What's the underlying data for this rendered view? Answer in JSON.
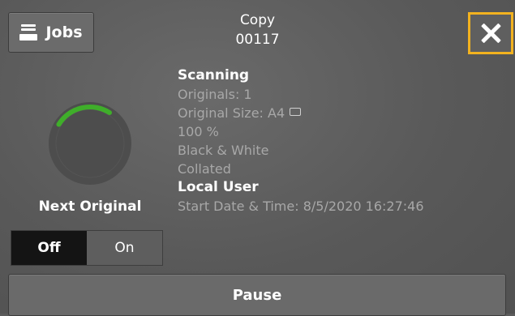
{
  "header": {
    "jobs_label": "Jobs",
    "title": "Copy",
    "job_number": "00117"
  },
  "status": {
    "heading": "Scanning",
    "originals": "Originals: 1",
    "original_size": "Original Size: A4",
    "scale": "100 %",
    "color_mode": "Black & White",
    "collation": "Collated",
    "user": "Local User",
    "start_time": "Start Date & Time: 8/5/2020 16:27:46"
  },
  "next_original": {
    "label": "Next Original",
    "off_label": "Off",
    "on_label": "On",
    "selected": "Off"
  },
  "actions": {
    "pause_label": "Pause"
  },
  "colors": {
    "accent_border": "#f2b21f",
    "progress_green": "#3fae2a"
  },
  "icons": {
    "jobs": "jobs-icon",
    "close": "close-icon",
    "size": "paper-orientation-icon"
  }
}
